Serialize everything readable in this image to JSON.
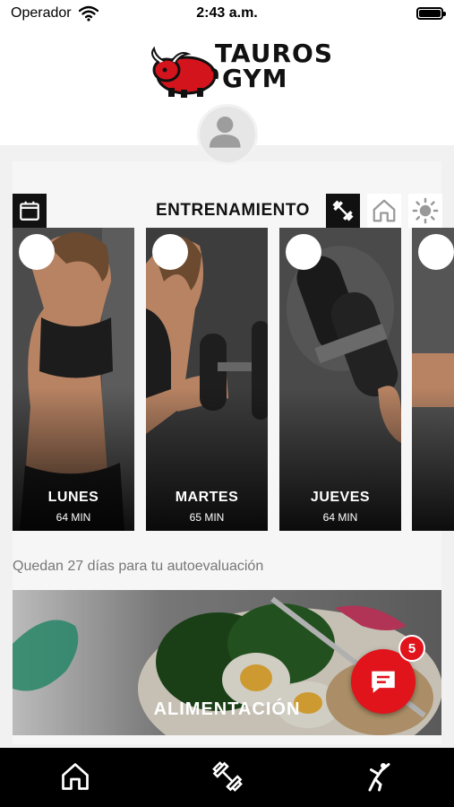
{
  "status_bar": {
    "carrier": "Operador",
    "time": "2:43 a.m."
  },
  "header": {
    "logo_line1": "TAUROS",
    "logo_line2": "GYM"
  },
  "training": {
    "title": "ENTRENAMIENTO",
    "modes": [
      "dumbbell-icon",
      "home-icon",
      "sun-icon"
    ],
    "active_mode": "dumbbell-icon",
    "cards": [
      {
        "day": "LUNES",
        "duration": "64 MIN"
      },
      {
        "day": "MARTES",
        "duration": "65 MIN"
      },
      {
        "day": "JUEVES",
        "duration": "64 MIN"
      }
    ]
  },
  "evaluation_note": "Quedan 27 días para tu autoevaluación",
  "nutrition": {
    "title": "ALIMENTACIÓN"
  },
  "chat": {
    "badge_count": "5"
  },
  "tab_bar": {
    "tabs": [
      "home-icon",
      "dumbbell-icon",
      "stretching-icon"
    ]
  },
  "colors": {
    "accent": "#e1131b",
    "dark": "#111111",
    "background": "#f1f1f1"
  }
}
